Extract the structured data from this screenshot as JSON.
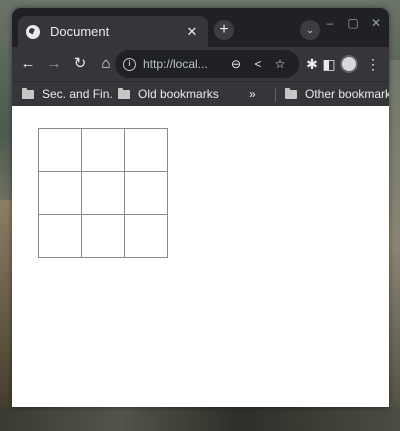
{
  "tab": {
    "title": "Document",
    "close": "✕"
  },
  "toolbar": {
    "new_tab": "+",
    "tab_search": "⌄",
    "back": "←",
    "forward": "→",
    "reload": "↻",
    "home": "⌂",
    "url": "http://local...",
    "zoom": "⊖",
    "share": "<",
    "star": "☆",
    "extensions": "✱",
    "sidepanel": "◧",
    "menu": "⋮"
  },
  "window_controls": {
    "minimize": "–",
    "maximize": "▢",
    "close": "✕"
  },
  "bookmarks": {
    "items": [
      "Sec. and Fin.",
      "Old bookmarks"
    ],
    "overflow": "»",
    "other": "Other bookmarks"
  },
  "page": {
    "grid": {
      "rows": 3,
      "cols": 3
    }
  },
  "colors": {
    "titlebar": "#202124",
    "toolbar": "#35363a",
    "grid_line": "#888888"
  }
}
